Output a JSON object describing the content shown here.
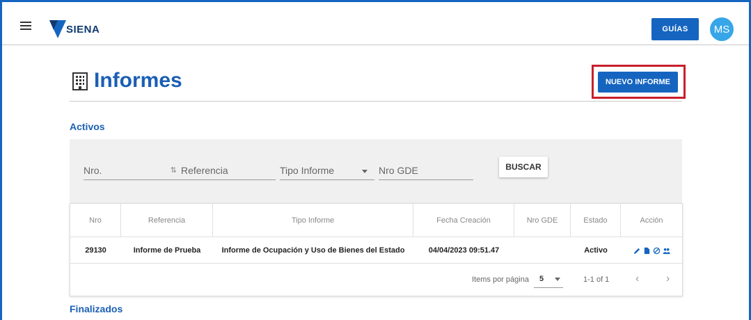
{
  "header": {
    "brand": "SIENA",
    "guides_label": "GUÍAS",
    "avatar_initials": "MS"
  },
  "page": {
    "title": "Informes",
    "new_report_label": "NUEVO INFORME"
  },
  "sections": {
    "active": "Activos",
    "finished": "Finalizados"
  },
  "filters": {
    "nro_placeholder": "Nro.",
    "referencia_placeholder": "Referencia",
    "tipo_placeholder": "Tipo Informe",
    "gde_placeholder": "Nro GDE",
    "search_label": "BUSCAR"
  },
  "table": {
    "columns": [
      "Nro",
      "Referencia",
      "Tipo Informe",
      "Fecha Creación",
      "Nro GDE",
      "Estado",
      "Acción"
    ],
    "rows": [
      [
        "29130",
        "Informe de Prueba",
        "Informe de Ocupación y Uso de Bienes del Estado",
        "04/04/2023 09:51.47",
        "",
        "Activo"
      ]
    ]
  },
  "paginator": {
    "items_label": "Items por página",
    "page_size": "5",
    "range": "1-1 of 1"
  },
  "colors": {
    "primary": "#1565c0",
    "title": "#1a5fb4",
    "highlight": "#c81e2b",
    "avatar": "#37a6e8"
  }
}
